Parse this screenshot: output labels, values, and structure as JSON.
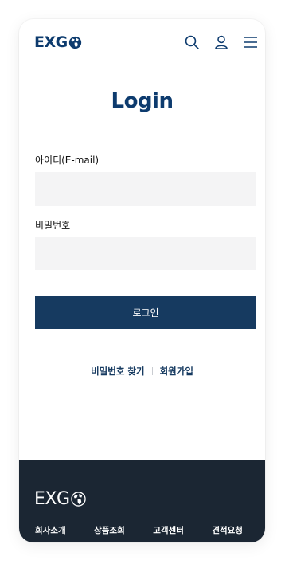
{
  "header": {
    "logo_text": "EXG",
    "icons": [
      "search-icon",
      "user-icon",
      "menu-icon"
    ]
  },
  "main": {
    "title": "Login",
    "id_label": "아이디(E-mail)",
    "id_value": "",
    "password_label": "비밀번호",
    "password_value": "",
    "login_button": "로그인",
    "find_password": "비밀번호 찾기",
    "signup": "회원가입"
  },
  "footer": {
    "logo_text": "EXG",
    "nav": [
      "회사소개",
      "상품조회",
      "고객센터",
      "견적요청"
    ]
  },
  "colors": {
    "brand": "#0d3b6e",
    "button": "#163a60",
    "field_bg": "#f4f4f5",
    "footer_bg": "#1b2633"
  }
}
